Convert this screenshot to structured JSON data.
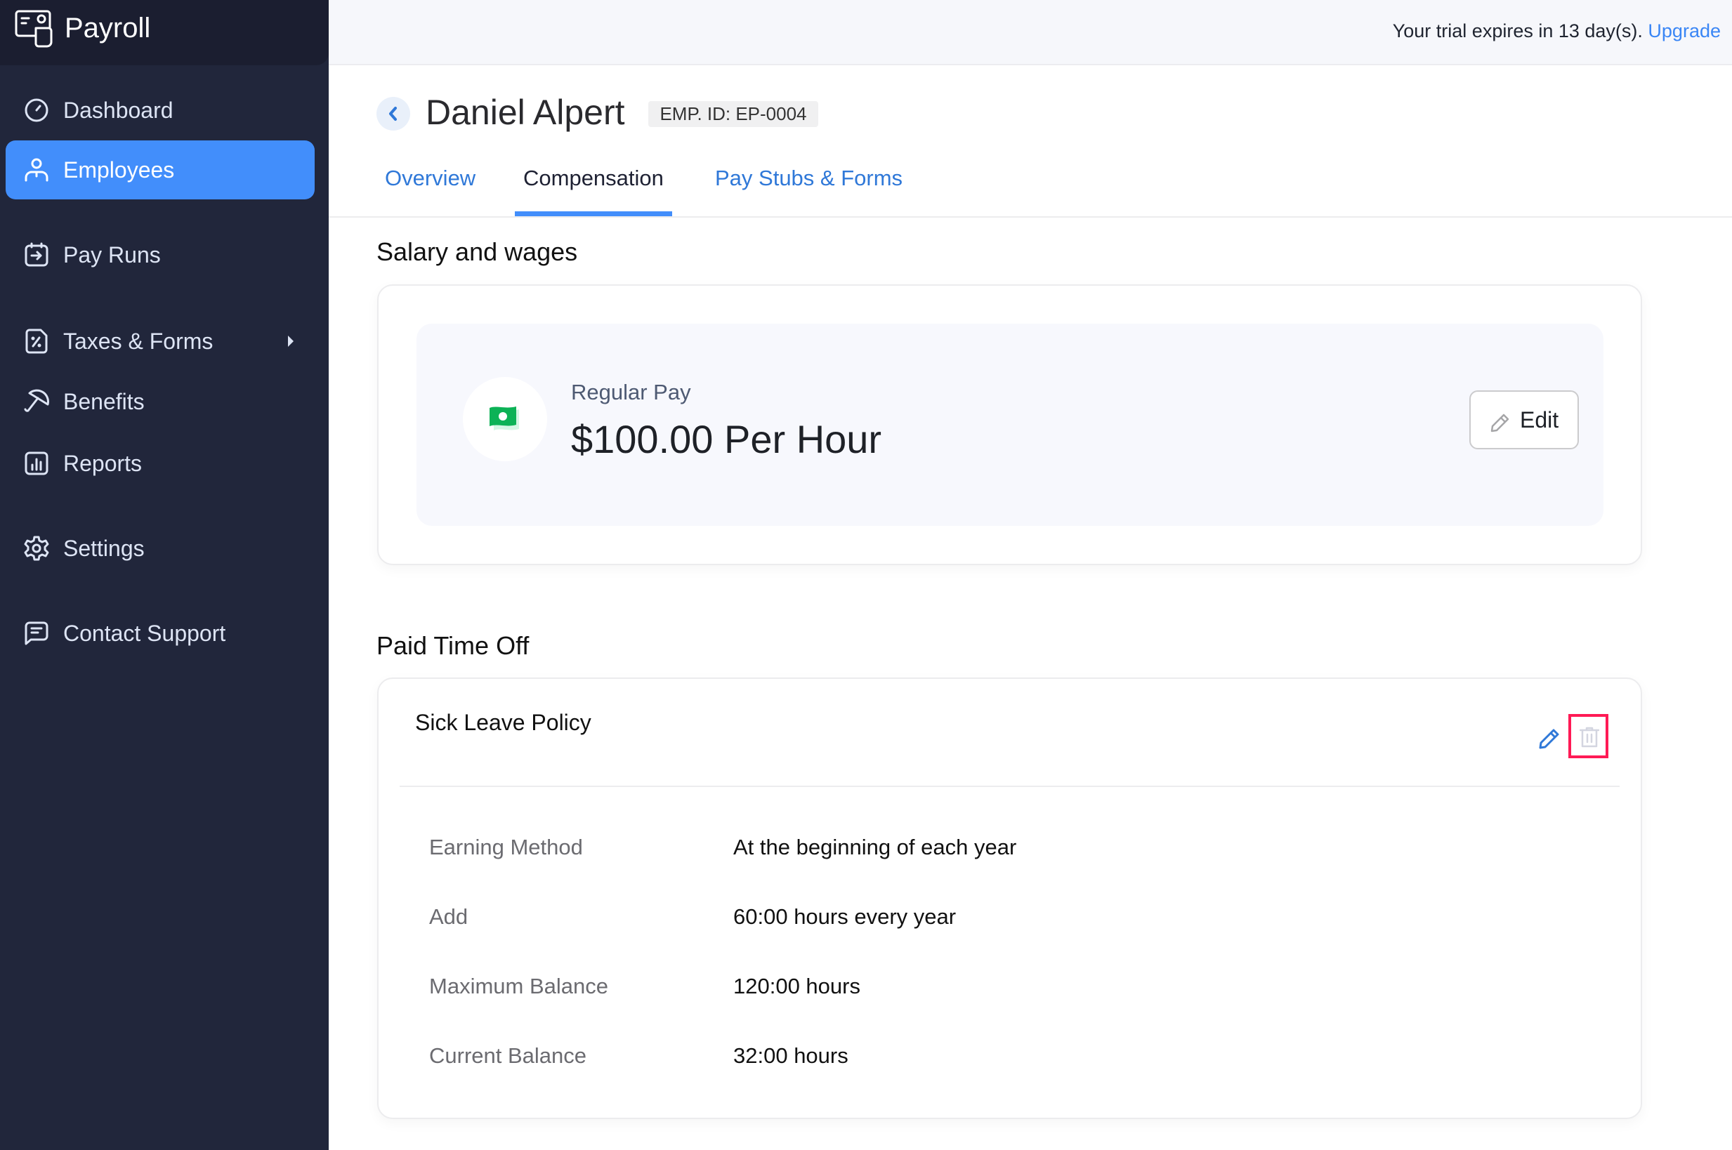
{
  "app": {
    "name": "Payroll",
    "logo_icon": "payroll-logo-icon"
  },
  "sidebar": {
    "items": [
      {
        "label": "Dashboard",
        "icon": "gauge-icon",
        "active": false
      },
      {
        "label": "Employees",
        "icon": "user-icon",
        "active": true
      },
      {
        "label": "Pay Runs",
        "icon": "calendar-arrow-icon",
        "active": false
      },
      {
        "label": "Taxes & Forms",
        "icon": "percent-document-icon",
        "active": false,
        "has_submenu": true
      },
      {
        "label": "Benefits",
        "icon": "umbrella-icon",
        "active": false
      },
      {
        "label": "Reports",
        "icon": "bar-chart-icon",
        "active": false
      },
      {
        "label": "Settings",
        "icon": "gear-icon",
        "active": false
      },
      {
        "label": "Contact Support",
        "icon": "chat-icon",
        "active": false
      }
    ]
  },
  "topbar": {
    "trial_text": "Your trial expires in 13 day(s).",
    "upgrade_label": "Upgrade",
    "accent_color": "#3a86f5"
  },
  "header": {
    "employee_name": "Daniel Alpert",
    "employee_id_badge": "EMP. ID: EP-0004",
    "back_icon": "chevron-left-icon"
  },
  "tabs": [
    {
      "label": "Overview",
      "active": false
    },
    {
      "label": "Compensation",
      "active": true
    },
    {
      "label": "Pay Stubs & Forms",
      "active": false
    }
  ],
  "salary": {
    "section_title": "Salary and wages",
    "pay_label": "Regular Pay",
    "pay_value": "$100.00 Per Hour",
    "pay_icon": "money-icon",
    "edit_label": "Edit"
  },
  "pto": {
    "section_title": "Paid Time Off",
    "policy_name": "Sick Leave Policy",
    "rows": [
      {
        "label": "Earning Method",
        "value": "At the beginning of each year"
      },
      {
        "label": "Add",
        "value": "60:00 hours every year"
      },
      {
        "label": "Maximum Balance",
        "value": "120:00 hours"
      },
      {
        "label": "Current Balance",
        "value": "32:00 hours"
      }
    ],
    "highlight_color": "#ff1a55"
  },
  "colors": {
    "sidebar_bg": "#21263b",
    "active_nav": "#428efb",
    "link": "#2f78d8",
    "money_green": "#0cb256"
  }
}
